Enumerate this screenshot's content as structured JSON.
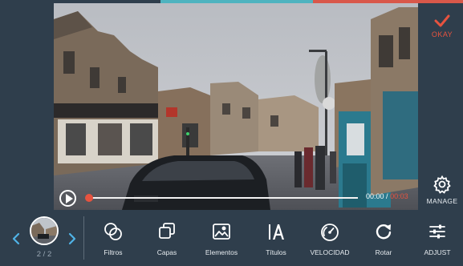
{
  "colors": {
    "background": "#2f3e4c",
    "accent": "#e7533f",
    "text": "#e6ebef",
    "muted": "#9aa8b4",
    "strip_teal": "#4fb3bf",
    "strip_red": "#d9584a"
  },
  "header": {
    "okay_label": "OKAY",
    "okay_icon": "checkmark-icon"
  },
  "side": {
    "manage_label": "MANAGE",
    "manage_icon": "gear-icon"
  },
  "player": {
    "play_icon": "play-icon",
    "current_time": "00:00",
    "separator": "/",
    "total_time": "00:03",
    "progress": 0.0
  },
  "clips": {
    "count": "2 / 2",
    "prev_icon": "chevron-left-icon",
    "next_icon": "chevron-right-icon"
  },
  "toolbar": {
    "tools": [
      {
        "label": "Filtros",
        "icon": "filters-icon"
      },
      {
        "label": "Capas",
        "icon": "layers-icon"
      },
      {
        "label": "Elementos",
        "icon": "image-icon"
      },
      {
        "label": "Títulos",
        "icon": "text-icon"
      },
      {
        "label": "VELOCIDAD",
        "icon": "speedometer-icon"
      },
      {
        "label": "Rotar",
        "icon": "rotate-icon"
      },
      {
        "label": "ADJUST",
        "icon": "sliders-icon"
      }
    ]
  }
}
